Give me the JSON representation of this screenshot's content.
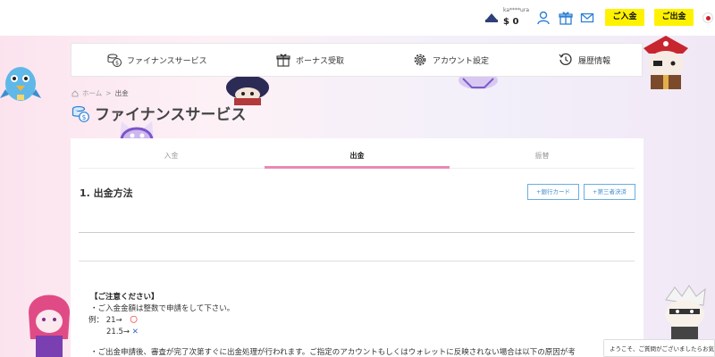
{
  "header": {
    "username": "ka****ura",
    "balance": "$ 0",
    "deposit_label": "ご入金",
    "withdraw_label": "ご出金",
    "icons": [
      "avatar-hat-icon",
      "user-icon",
      "gift-icon",
      "mail-icon",
      "japan-flag-icon"
    ]
  },
  "nav": {
    "items": [
      {
        "label": "ファイナンスサービス",
        "icon": "coin-dollar-icon"
      },
      {
        "label": "ボーナス受取",
        "icon": "gift-box-icon"
      },
      {
        "label": "アカウント設定",
        "icon": "gear-icon"
      },
      {
        "label": "履歴情報",
        "icon": "history-clock-icon"
      }
    ]
  },
  "breadcrumb": {
    "home": "ホーム",
    "current": "出金"
  },
  "page": {
    "title": "ファイナンスサービス"
  },
  "tabs": [
    {
      "label": "入金",
      "active": false
    },
    {
      "label": "出金",
      "active": true
    },
    {
      "label": "振替",
      "active": false
    }
  ],
  "withdraw": {
    "section_title": "1. 出金方法",
    "add_bank_card": "+銀行カード",
    "add_third_party": "+第三者決済"
  },
  "notice": {
    "heading": "【ご注意ください】",
    "line1": "・ご入金金額は整数で申請をして下さい。",
    "example_prefix": "例：",
    "example1_value": "21→",
    "example1_mark": "〇",
    "example2_value": "21.5→",
    "example2_mark": "✕",
    "line_bottom": "・ご出金申請後、審査が完了次第すぐに出金処理が行われます。ご指定のアカウントもしくはウォレットに反映されない場合は以下の原因が考"
  },
  "chat": {
    "text": "ようこそ、ご質問がございましたらお気軽"
  },
  "colors": {
    "accent_yellow": "#fff200",
    "tab_underline": "#e88ab4",
    "link_blue": "#3d8fd1",
    "icon_blue": "#2d7fd6"
  }
}
